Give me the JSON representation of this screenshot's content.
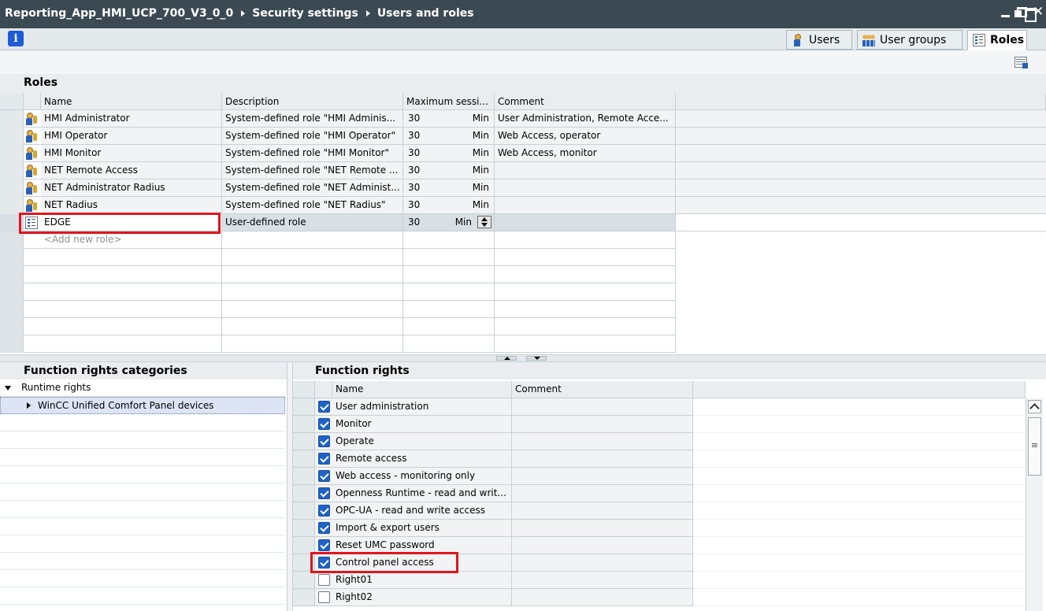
{
  "titlebar": {
    "crumbs": [
      "Reporting_App_HMI_UCP_700_V3_0_0",
      "Security settings",
      "Users and roles"
    ]
  },
  "tabs": [
    {
      "label": "Users",
      "icon": "user-icon",
      "active": false
    },
    {
      "label": "User groups",
      "icon": "user-groups-icon",
      "active": false
    },
    {
      "label": "Roles",
      "icon": "roles-icon",
      "active": true
    }
  ],
  "roles": {
    "title": "Roles",
    "columns": [
      "Name",
      "Description",
      "Maximum sessi...",
      "Comment"
    ],
    "rows": [
      {
        "name": "HMI Administrator",
        "description": "System-defined role \"HMI Adminis...",
        "max": "30",
        "unit": "Min",
        "comment": "User Administration, Remote Acce..."
      },
      {
        "name": "HMI Operator",
        "description": "System-defined role \"HMI Operator\"",
        "max": "30",
        "unit": "Min",
        "comment": "Web Access, operator"
      },
      {
        "name": "HMI Monitor",
        "description": "System-defined role \"HMI Monitor\"",
        "max": "30",
        "unit": "Min",
        "comment": "Web Access, monitor"
      },
      {
        "name": "NET Remote Access",
        "description": "System-defined role \"NET Remote ...",
        "max": "30",
        "unit": "Min",
        "comment": ""
      },
      {
        "name": "NET Administrator Radius",
        "description": "System-defined role \"NET Administ...",
        "max": "30",
        "unit": "Min",
        "comment": ""
      },
      {
        "name": "NET Radius",
        "description": "System-defined role \"NET Radius\"",
        "max": "30",
        "unit": "Min",
        "comment": ""
      }
    ],
    "edited_row": {
      "name": "EDGE",
      "description": "User-defined role",
      "max": "30",
      "unit": "Min",
      "comment": ""
    },
    "add_new": "<Add new role>"
  },
  "categories": {
    "title": "Function rights categories",
    "root": "Runtime rights",
    "child": "WinCC Unified Comfort Panel devices"
  },
  "function_rights": {
    "title": "Function rights",
    "columns": [
      "Name",
      "Comment"
    ],
    "rows": [
      {
        "name": "User administration",
        "checked": true
      },
      {
        "name": "Monitor",
        "checked": true
      },
      {
        "name": "Operate",
        "checked": true
      },
      {
        "name": "Remote access",
        "checked": true
      },
      {
        "name": "Web access - monitoring only",
        "checked": true
      },
      {
        "name": "Openness Runtime - read and writ...",
        "checked": true
      },
      {
        "name": "OPC-UA - read and write access",
        "checked": true
      },
      {
        "name": "Import & export users",
        "checked": true
      },
      {
        "name": "Reset UMC password",
        "checked": true
      },
      {
        "name": "Control panel access",
        "checked": true
      },
      {
        "name": "Right01",
        "checked": false
      },
      {
        "name": "Right02",
        "checked": false
      }
    ]
  },
  "colors": {
    "titlebar": "#3b4a52",
    "highlight": "#e2141c",
    "checkbox": "#1f63c9"
  }
}
